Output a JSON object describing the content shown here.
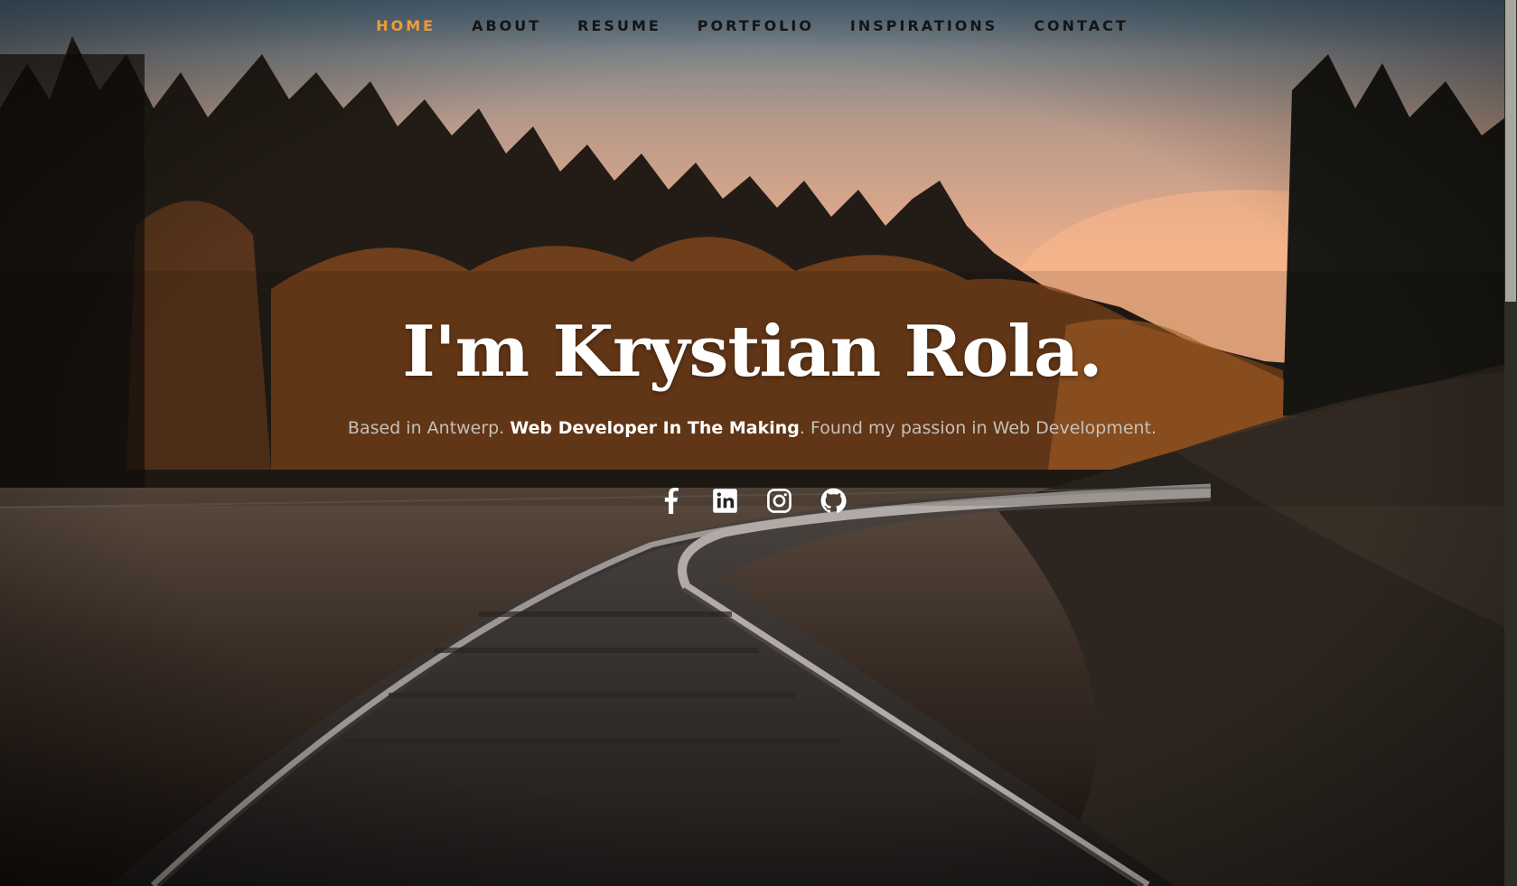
{
  "nav": {
    "items": [
      {
        "label": "HOME",
        "active": true
      },
      {
        "label": "ABOUT",
        "active": false
      },
      {
        "label": "RESUME",
        "active": false
      },
      {
        "label": "PORTFOLIO",
        "active": false
      },
      {
        "label": "INSPIRATIONS",
        "active": false
      },
      {
        "label": "CONTACT",
        "active": false
      }
    ],
    "active_color": "#f29a3a"
  },
  "hero": {
    "title": "I'm Krystian Rola.",
    "subtitle": {
      "part1": "Based in Antwerp. ",
      "highlight": "Web Developer In The Making",
      "part2": ". Found my passion in Web Development."
    }
  },
  "social": [
    {
      "icon": "facebook-icon"
    },
    {
      "icon": "linkedin-icon"
    },
    {
      "icon": "instagram-icon"
    },
    {
      "icon": "github-icon"
    }
  ]
}
